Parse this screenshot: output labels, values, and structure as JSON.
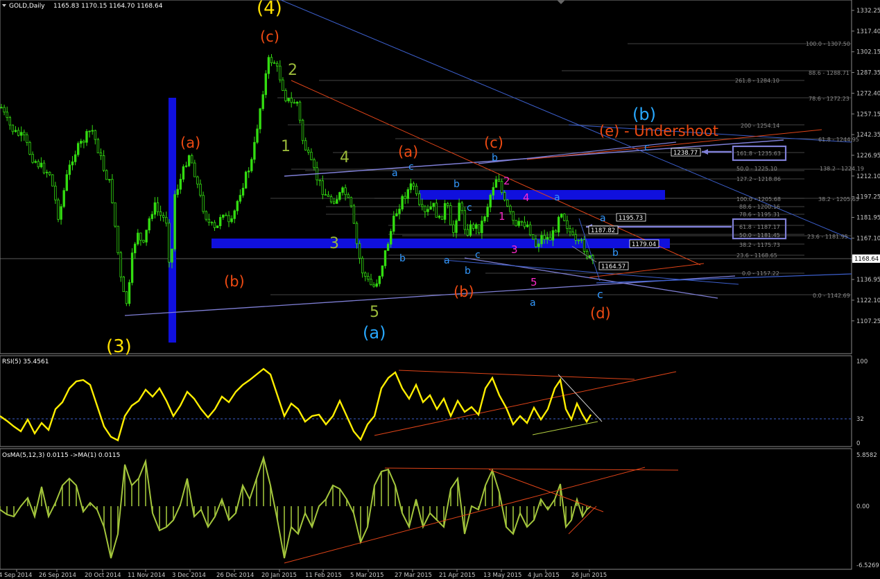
{
  "window": {
    "symbol_label": "GOLD,Daily",
    "ohlc_text": "1165.83 1170.15 1164.70 1168.64",
    "menu_icon": "triangle-down-icon"
  },
  "colors": {
    "background": "#000000",
    "candles": "#33dd11",
    "axis_text": "#c8c8c8",
    "fib_text": "#8a8a8a",
    "rsi_line": "#ffee00",
    "osma_line": "#a4c63c",
    "osma_hist": "#9ec23a",
    "blue_zone": "#1010dd",
    "trend_purple": "#7f7fd6",
    "trend_blue": "#3c5fcc",
    "trend_red": "#e04418",
    "wave_yellow": "#ffe000",
    "wave_orange": "#ee4a12",
    "wave_green": "#9bba3a",
    "wave_cyan": "#28a8ff",
    "wave_blue": "#3399ff",
    "wave_magenta": "#ff2acd"
  },
  "price_axis": {
    "ticks": [
      "1332.25",
      "1317.40",
      "1302.15",
      "1287.35",
      "1272.40",
      "1257.15",
      "1242.35",
      "1226.95",
      "1212.10",
      "1197.25",
      "1181.95",
      "1167.10",
      "1152.25",
      "1136.95",
      "1122.10",
      "1107.25"
    ],
    "current_price": "1168.64"
  },
  "time_axis": {
    "labels": [
      "4 Sep 2014",
      "26 Sep 2014",
      "20 Oct 2014",
      "11 Nov 2014",
      "3 Dec 2014",
      "26 Dec 2014",
      "20 Jan 2015",
      "11 Feb 2015",
      "5 Mar 2015",
      "27 Mar 2015",
      "21 Apr 2015",
      "13 May 2015",
      "4 Jun 2015",
      "26 Jun 2015"
    ]
  },
  "chart_data": [
    {
      "type": "candlestick",
      "title": "GOLD,Daily",
      "ylim": [
        1100,
        1340
      ],
      "ohlc_last": {
        "open": 1165.83,
        "high": 1170.15,
        "low": 1164.7,
        "close": 1168.64
      },
      "approx_closes": [
        {
          "date": "4 Sep 2014",
          "value": 1268
        },
        {
          "date": "26 Sep 2014",
          "value": 1222
        },
        {
          "date": "20 Oct 2014",
          "value": 1245
        },
        {
          "date": "11 Nov 2014",
          "value": 1160
        },
        {
          "date": "3 Dec 2014",
          "value": 1210
        },
        {
          "date": "26 Dec 2014",
          "value": 1195
        },
        {
          "date": "20 Jan 2015",
          "value": 1294
        },
        {
          "date": "11 Feb 2015",
          "value": 1232
        },
        {
          "date": "5 Mar 2015",
          "value": 1170
        },
        {
          "date": "27 Mar 2015",
          "value": 1200
        },
        {
          "date": "21 Apr 2015",
          "value": 1195
        },
        {
          "date": "13 May 2015",
          "value": 1222
        },
        {
          "date": "4 Jun 2015",
          "value": 1178
        },
        {
          "date": "26 Jun 2015",
          "value": 1169
        }
      ],
      "fib_levels": [
        "100.0 - 1307.50",
        "88.6 - 1288.71",
        "261.8 - 1284.10",
        "78.6 - 1272.23",
        "200 - 1254.14",
        "61.8 - 1244.95",
        "161.8 - 1235.63",
        "138.2 - 1224.19",
        "50.0 - 1225.10",
        "127.2 - 1218.86",
        "100.0 - 1205.68",
        "38.2 - 1205.65",
        "88.6 - 1200.16",
        "78.6 - 1195.31",
        "61.8 - 1187.17",
        "50.0 - 1181.45",
        "23.6 - 1181.95",
        "38.2 - 1175.73",
        "23.6 - 1168.65",
        "0.0 - 1157.22",
        "0.0 - 1142.69"
      ],
      "price_tags": [
        "1238.77",
        "1195.73",
        "1187.82",
        "1179.04",
        "1164.57"
      ],
      "wave_labels": {
        "primary": [
          "(4)",
          "(3)"
        ],
        "intermediate": [
          "(c)",
          "(a)",
          "(b)",
          "(a)",
          "(c)",
          "(b)",
          "(d)",
          "(e) - Undershoot"
        ],
        "degree_blue": [
          "(b)",
          "(a)"
        ],
        "impulse": [
          "2",
          "1",
          "4",
          "3",
          "5"
        ],
        "minor": [
          "1",
          "2",
          "3",
          "4",
          "5"
        ],
        "minute": [
          "a",
          "c",
          "b",
          "a",
          "b",
          "c",
          "b",
          "c",
          "b",
          "a",
          "b",
          "a",
          "c",
          "a",
          "c"
        ]
      }
    },
    {
      "type": "line",
      "title": "RSI(5) 35.4561",
      "ylim": [
        0,
        100
      ],
      "ticks": [
        "100",
        "32",
        "0"
      ],
      "reference_level": 32,
      "last_value": 35.4561
    },
    {
      "type": "bar",
      "title": "OsMA(5,12,3) 0.0115  ->MA(1) 0.0115",
      "ylim": [
        -6.5269,
        5.8582
      ],
      "ticks": [
        "5.8582",
        "0.00",
        "-6.5269"
      ],
      "last_value": 0.0115
    }
  ]
}
